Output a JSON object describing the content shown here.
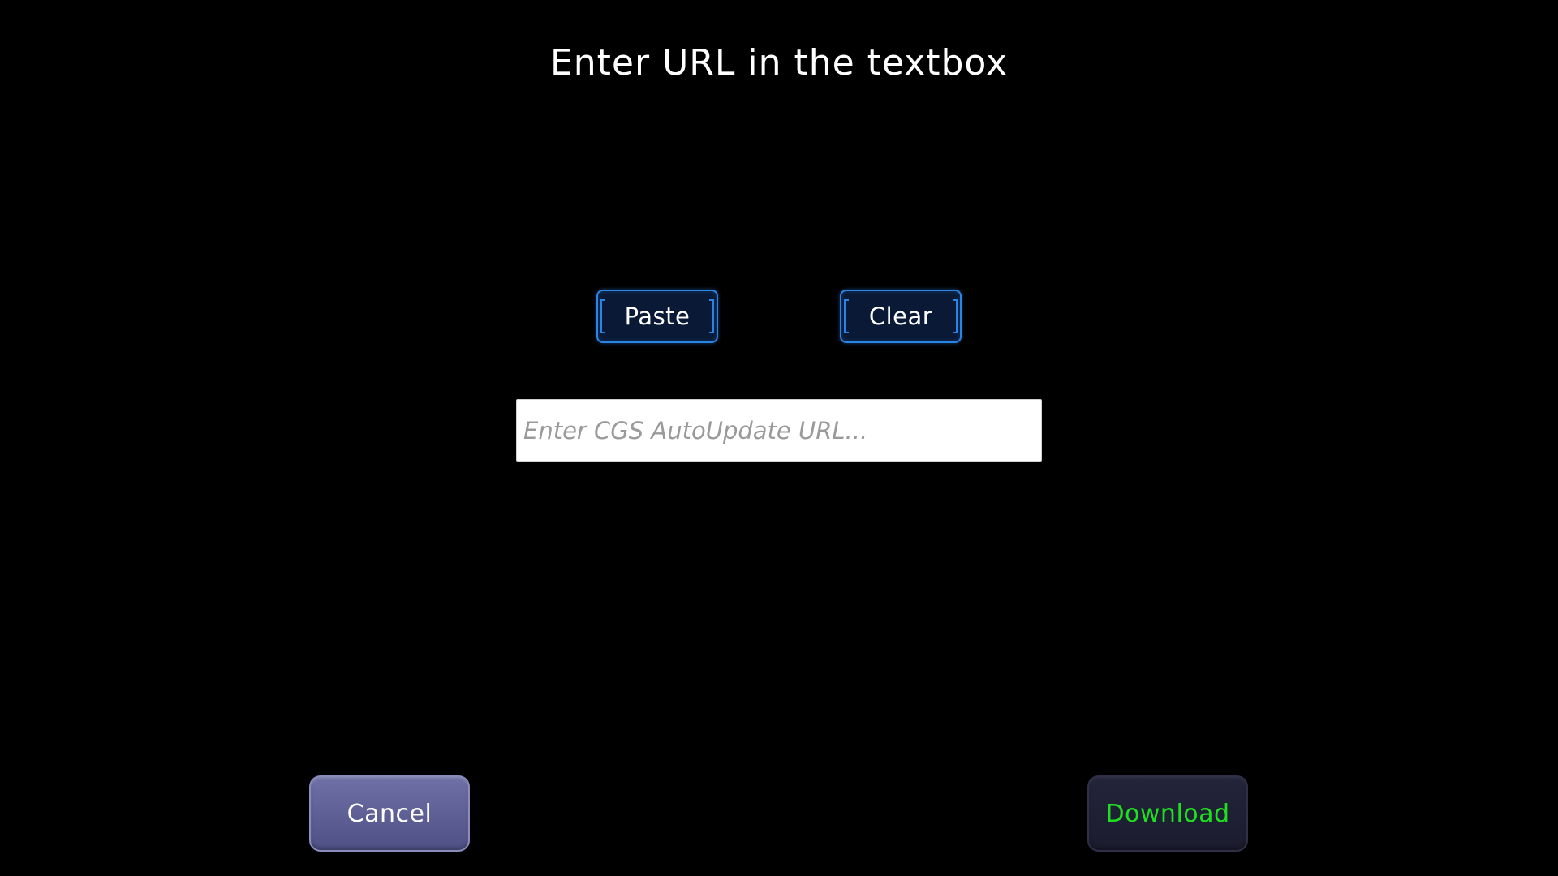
{
  "title": "Enter URL in the textbox",
  "buttons": {
    "paste_label": "Paste",
    "clear_label": "Clear",
    "cancel_label": "Cancel",
    "download_label": "Download"
  },
  "url_input": {
    "value": "",
    "placeholder": "Enter CGS AutoUpdate URL..."
  },
  "colors": {
    "background": "#000000",
    "small_button_border": "#2a84e6",
    "cancel_button": "#5f6196",
    "download_button": "#1f2033",
    "download_text": "#1fe01f"
  }
}
